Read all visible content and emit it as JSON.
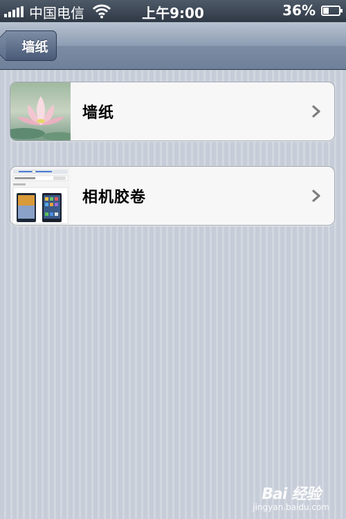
{
  "status_bar": {
    "carrier": "中国电信",
    "time": "上午9:00",
    "battery_percent": "36%",
    "battery_level": 0.36,
    "icons": [
      "signal-icon",
      "wifi-icon",
      "battery-icon"
    ]
  },
  "nav": {
    "back_label": "墙纸"
  },
  "items": [
    {
      "label": "墙纸",
      "thumb": "lotus-thumbnail",
      "chevron": "chevron-right-icon"
    },
    {
      "label": "相机胶卷",
      "thumb": "settings-screenshot-thumbnail",
      "chevron": "chevron-right-icon"
    }
  ],
  "watermark": {
    "logo": "Bai 经验",
    "sub": "jingyan.baidu.com"
  },
  "colors": {
    "nav_top": "#b7c2d1",
    "nav_bottom": "#6f8099",
    "back_button": "#485a77",
    "background": "#c9cfd9",
    "cell": "#f7f7f7"
  }
}
